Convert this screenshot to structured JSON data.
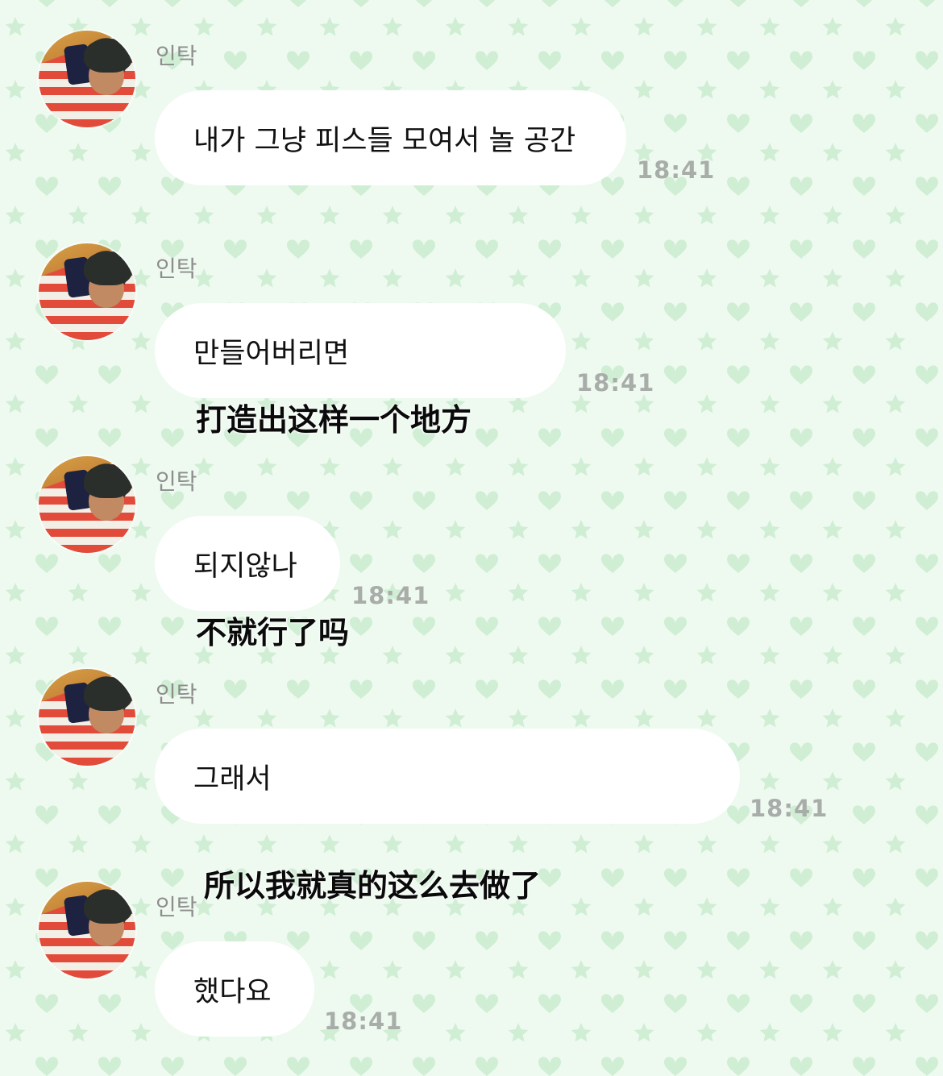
{
  "colors": {
    "background": "#eefaf0",
    "pattern": "#cfeed4",
    "bubble": "#ffffff",
    "name_text": "#8d8d8d",
    "time_text": "#a9adaa"
  },
  "icons": {
    "background_pattern": [
      "heart-icon",
      "star-icon"
    ]
  },
  "messages": [
    {
      "sender": "인탁",
      "text": "내가 그냥 피스들 모여서 놀 공간",
      "time": "18:41",
      "caption": ""
    },
    {
      "sender": "인탁",
      "text": "만들어버리면",
      "time": "18:41",
      "caption": "打造出这样一个地方"
    },
    {
      "sender": "인탁",
      "text": "되지않나",
      "time": "18:41",
      "caption": "不就行了吗"
    },
    {
      "sender": "인탁",
      "text": "그래서",
      "time": "18:41",
      "caption": "所以我就真的这么去做了"
    },
    {
      "sender": "인탁",
      "text": "했다요",
      "time": "18:41",
      "caption": ""
    }
  ]
}
